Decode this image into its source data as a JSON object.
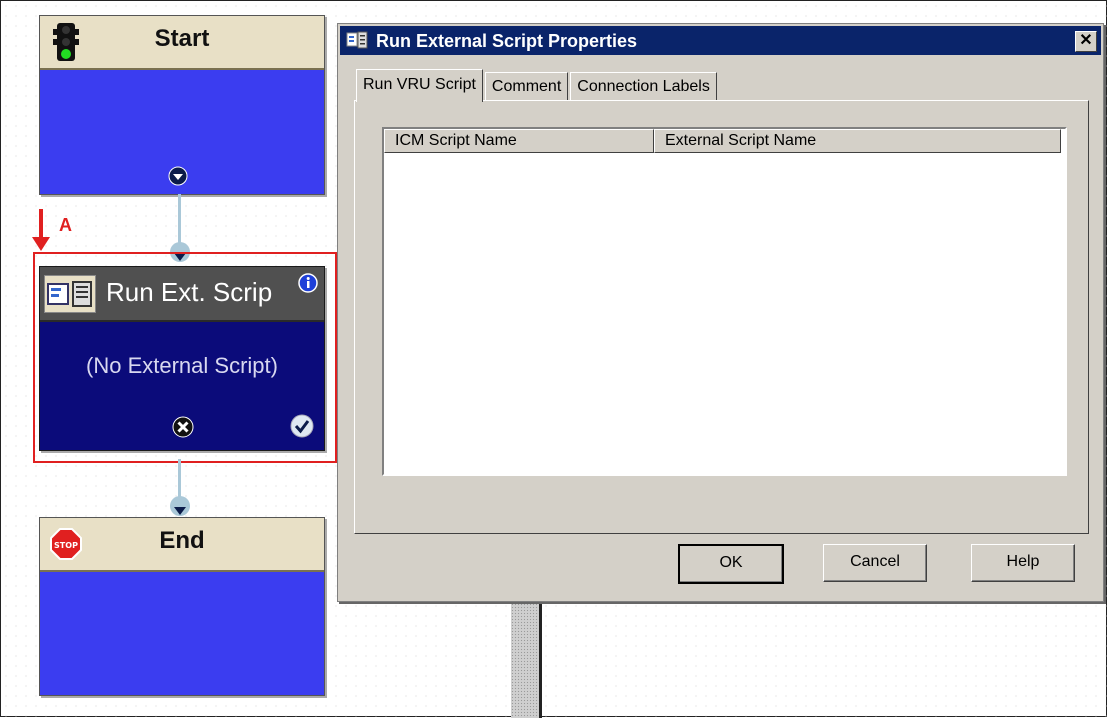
{
  "canvas": {
    "start_node": {
      "title": "Start"
    },
    "annotation": {
      "label": "A"
    },
    "run_ext_node": {
      "title": "Run Ext. Scrip",
      "body_text": "(No External Script)"
    },
    "end_node": {
      "title": "End",
      "stop_sign_text": "STOP"
    }
  },
  "dialog": {
    "title": "Run External Script Properties",
    "close_label": "✕",
    "tabs": [
      {
        "label": "Run VRU Script",
        "active": true
      },
      {
        "label": "Comment",
        "active": false
      },
      {
        "label": "Connection Labels",
        "active": false
      }
    ],
    "table": {
      "columns": [
        "ICM Script Name",
        "External Script Name"
      ],
      "rows": []
    },
    "buttons": {
      "ok": "OK",
      "cancel": "Cancel",
      "help": "Help"
    }
  },
  "colors": {
    "node_body_blue": "#3b3df0",
    "selected_node_body": "#0b0b7a",
    "selection_outline": "#e02020",
    "titlebar": "#0a246a",
    "dialog_face": "#d4d0c8"
  },
  "icons": [
    "traffic-light-icon",
    "info-icon",
    "script-node-icon",
    "success-check-icon",
    "failure-x-icon",
    "stop-sign-icon",
    "down-port-icon",
    "dialog-app-icon",
    "close-icon"
  ]
}
